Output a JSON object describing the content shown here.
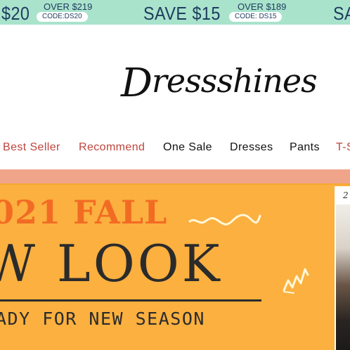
{
  "promo": {
    "offers": [
      {
        "save": "$20",
        "over": "",
        "code": ""
      },
      {
        "save": "",
        "over": "OVER $219",
        "code": "CODE:DS20"
      },
      {
        "save": "SAVE $15",
        "over": "OVER $189",
        "code": "CODE: DS15"
      },
      {
        "save": "SA",
        "over": "",
        "code": ""
      }
    ]
  },
  "logo": {
    "cap": "D",
    "rest": "ressshines"
  },
  "nav": {
    "items": [
      {
        "label": "Best Seller"
      },
      {
        "label": "Recommend"
      },
      {
        "label": "One Sale"
      },
      {
        "label": "Dresses"
      },
      {
        "label": "Pants"
      },
      {
        "label": "T-S"
      }
    ]
  },
  "hero": {
    "headline": "021 FALL",
    "title": "W LOOK",
    "subtitle": "ADY FOR NEW SEASON",
    "side_number": "2"
  },
  "colors": {
    "promo_bg": "#a9e3cc",
    "nav_accent": "#c0453d",
    "strip": "#f0a58a",
    "hero_bg": "#fbb03f",
    "hero_orange": "#f26b23"
  }
}
